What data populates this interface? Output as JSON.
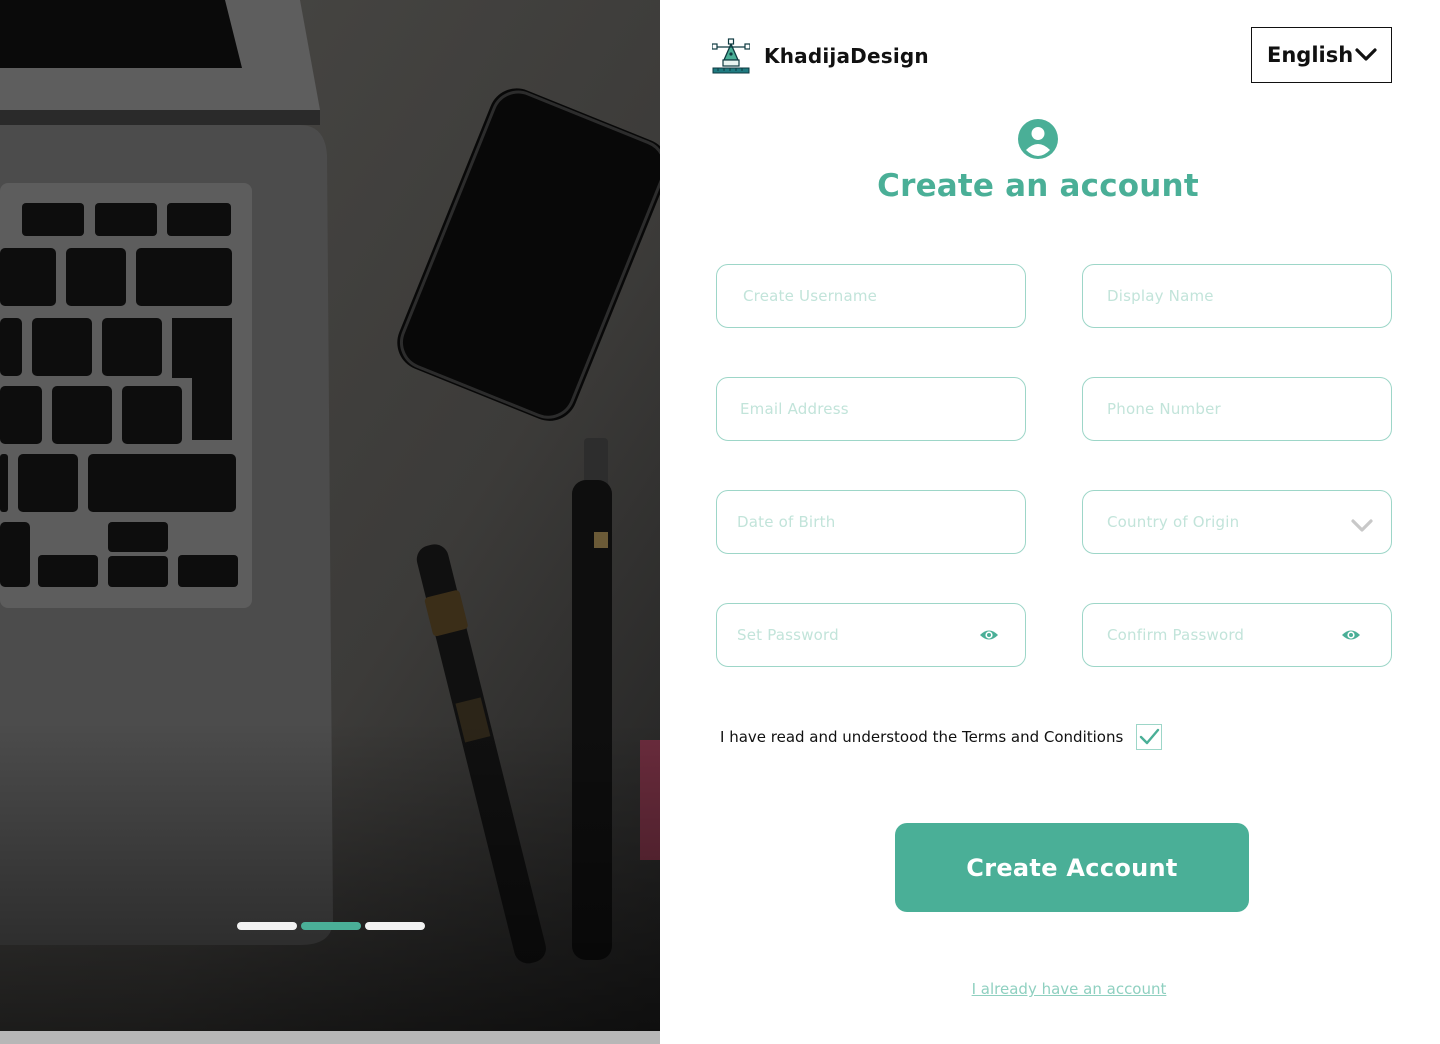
{
  "brand": {
    "name": "KhadijaDesign",
    "logo_icon": "design-tools-icon"
  },
  "language": {
    "selected": "English",
    "icon": "chevron-down-icon"
  },
  "header": {
    "icon": "user-circle-icon",
    "title": "Create an account"
  },
  "form": {
    "username_placeholder": "Create Username",
    "display_name_placeholder": "Display Name",
    "email_placeholder": "Email  Address",
    "phone_placeholder": "Phone Number",
    "dob_placeholder": "Date of Birth",
    "country_placeholder": "Country of Origin",
    "password_placeholder": "Set Password",
    "confirm_password_placeholder": "Confirm  Password"
  },
  "terms": {
    "label": "I have read and understood the Terms and Conditions",
    "checked": true
  },
  "actions": {
    "create_label": "Create Account",
    "login_link": "I already have an account"
  },
  "carousel": {
    "count": 3,
    "active_index": 1
  },
  "colors": {
    "accent": "#4aaf97",
    "field_border": "#9dd6c8",
    "placeholder": "#c2e4da",
    "text": "#111111"
  }
}
